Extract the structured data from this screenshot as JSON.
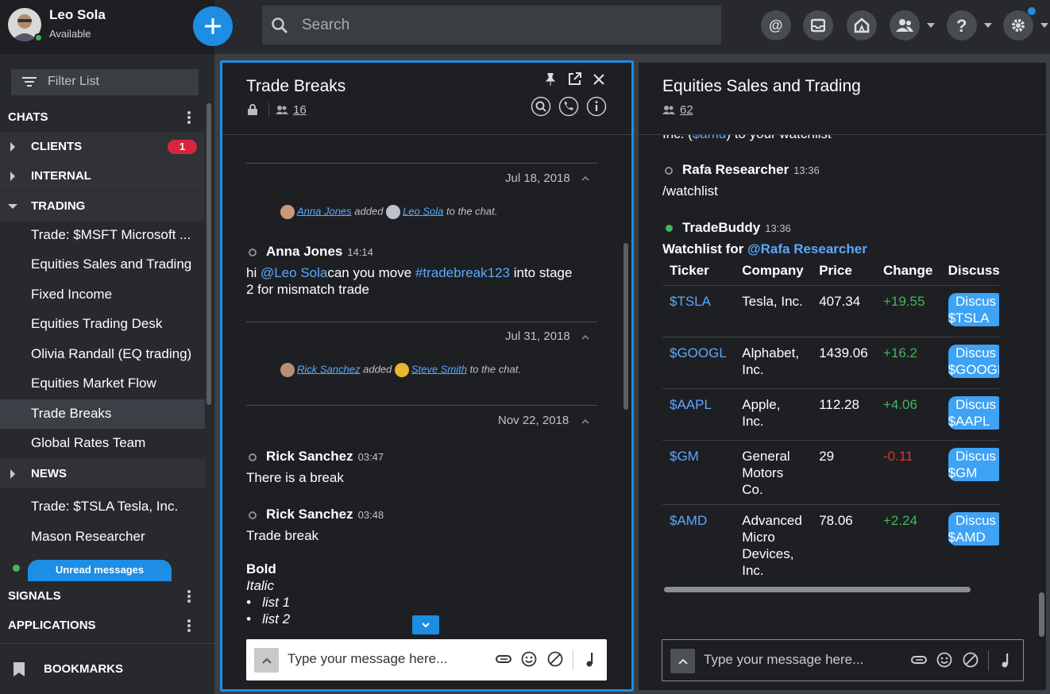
{
  "user": {
    "name": "Leo Sola",
    "status": "Available"
  },
  "sidebar": {
    "filter_placeholder": "Filter List",
    "chats_label": "CHATS",
    "groups": [
      {
        "label": "CLIENTS",
        "badge": "1"
      },
      {
        "label": "INTERNAL"
      },
      {
        "label": "TRADING"
      }
    ],
    "trading_items": [
      "Trade: $MSFT Microsoft ...",
      "Equities Sales and Trading",
      "Fixed Income",
      "Equities Trading Desk",
      "Olivia Randall (EQ trading)",
      "Equities Market Flow",
      "Trade Breaks",
      "Global Rates Team"
    ],
    "news_label": "NEWS",
    "news_items": [
      "Trade: $TSLA Tesla, Inc.",
      "Mason Researcher"
    ],
    "unread_label": "Unread messages",
    "signals_label": "SIGNALS",
    "applications_label": "APPLICATIONS",
    "bookmarks_label": "BOOKMARKS"
  },
  "topbar": {
    "search_placeholder": "Search"
  },
  "left_panel": {
    "title": "Trade Breaks",
    "member_count": "16",
    "dates": [
      "Jul 18, 2018",
      "Jul 31, 2018",
      "Nov 22, 2018"
    ],
    "sys1": {
      "actor": "Anna Jones",
      "verb": "added",
      "target": "Leo Sola",
      "tail": "to the chat."
    },
    "sys2": {
      "actor": "Rick Sanchez",
      "verb": "added",
      "target": "Steve Smith",
      "tail": "to the chat."
    },
    "msg1": {
      "author": "Anna Jones",
      "time": "14:14",
      "pre": "hi ",
      "mention": "@Leo Sola",
      "mid": "can you move ",
      "tag": "#tradebreak123",
      "post": " into stage",
      "line2": "2 for mismatch trade"
    },
    "msg2": {
      "author": "Rick Sanchez",
      "time": "03:47",
      "text": "There is a break"
    },
    "msg3": {
      "author": "Rick Sanchez",
      "time": "03:48",
      "text": "Trade break",
      "bold": "Bold",
      "italic": "Italic",
      "list": [
        "list 1",
        "list 2"
      ]
    },
    "composer_placeholder": "Type your message here..."
  },
  "right_panel": {
    "title": "Equities Sales and Trading",
    "member_count": "62",
    "partial_line": {
      "pre": "Inc. (",
      "ticker": "$amd",
      "post": ") to your watchlist"
    },
    "msg1": {
      "author": "Rafa Researcher",
      "time": "13:36",
      "text": "/watchlist"
    },
    "msg2": {
      "author": "TradeBuddy",
      "time": "13:36",
      "pre": "Watchlist for ",
      "mention": "@Rafa Researcher"
    },
    "table_headers": [
      "Ticker",
      "Company",
      "Price",
      "Change",
      "Discuss"
    ],
    "rows": [
      {
        "ticker": "$TSLA",
        "company": [
          "Tesla, Inc."
        ],
        "price": "407.34",
        "change": "+19.55",
        "discuss": [
          "Discus",
          "$TSLA"
        ]
      },
      {
        "ticker": "$GOOGL",
        "company": [
          "Alphabet,",
          "Inc."
        ],
        "price": "1439.06",
        "change": "+16.2",
        "discuss": [
          "Discus",
          "$GOOGL"
        ]
      },
      {
        "ticker": "$AAPL",
        "company": [
          "Apple,",
          "Inc."
        ],
        "price": "112.28",
        "change": "+4.06",
        "discuss": [
          "Discus",
          "$AAPL"
        ]
      },
      {
        "ticker": "$GM",
        "company": [
          "General",
          "Motors",
          "Co."
        ],
        "price": "29",
        "change": "-0.11",
        "discuss": [
          "Discus",
          "$GM"
        ]
      },
      {
        "ticker": "$AMD",
        "company": [
          "Advanced",
          "Micro",
          "Devices,",
          "Inc."
        ],
        "price": "78.06",
        "change": "+2.24",
        "discuss": [
          "Discus",
          "$AMD"
        ]
      }
    ],
    "composer_placeholder": "Type your message here..."
  },
  "colors": {
    "accent": "#1d8ee4",
    "positive": "#43b65a",
    "negative": "#e03030",
    "link": "#5aa8ff",
    "badge": "#d7263d"
  }
}
